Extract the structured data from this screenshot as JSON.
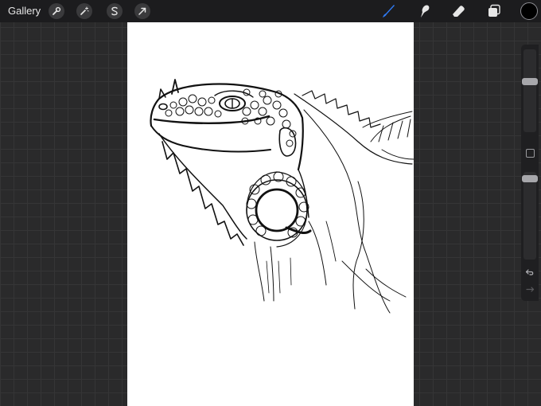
{
  "topbar": {
    "gallery_label": "Gallery",
    "left_tools": [
      "wrench-icon",
      "magic-wand-icon",
      "selection-s-icon",
      "transform-arrow-icon"
    ],
    "right_tools": [
      "brush-icon",
      "smudge-icon",
      "eraser-icon",
      "layers-icon",
      "color-swatch"
    ],
    "active_tool": "brush",
    "accent_color": "#2f7bf5",
    "current_color": "#000000"
  },
  "sidebar": {
    "brush_size_fraction": 0.2,
    "opacity_fraction": 0.05,
    "icons": [
      "modify-square-icon",
      "undo-icon",
      "redo-icon"
    ]
  }
}
